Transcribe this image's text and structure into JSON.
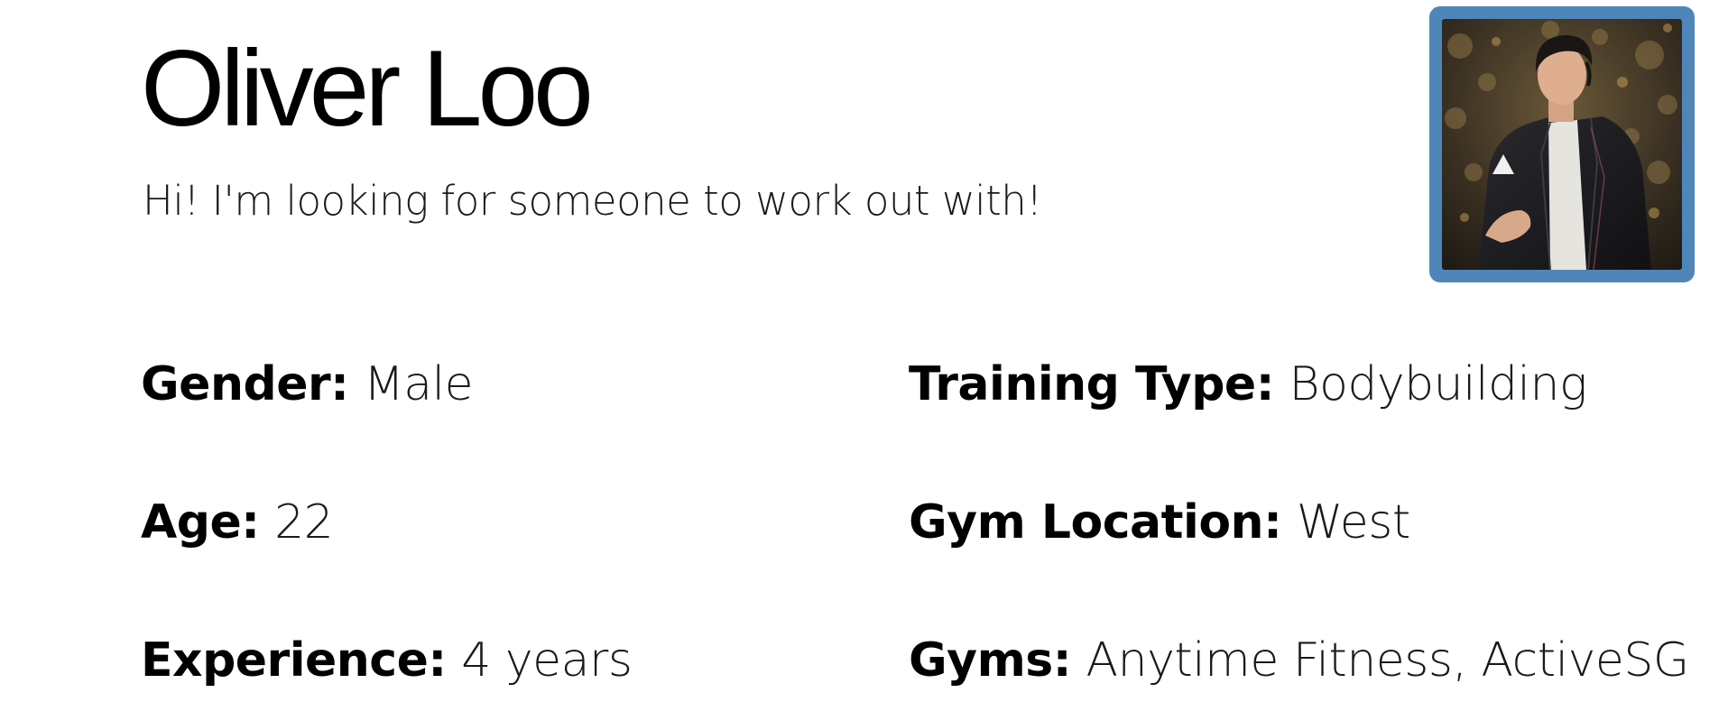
{
  "profile": {
    "name": "Oliver Loo",
    "bio": "Hi! I'm looking for someone to work out with!",
    "avatar_description": "profile photo"
  },
  "details": {
    "gender": {
      "label": "Gender:",
      "value": "Male"
    },
    "age": {
      "label": "Age:",
      "value": "22"
    },
    "experience": {
      "label": "Experience:",
      "value": "4 years"
    },
    "training_type": {
      "label": "Training Type:",
      "value": "Bodybuilding"
    },
    "gym_location": {
      "label": "Gym Location:",
      "value": "West"
    },
    "gyms": {
      "label": "Gyms:",
      "value": "Anytime Fitness, ActiveSG"
    }
  },
  "colors": {
    "avatar_border": "#4f86b9",
    "text": "#000000",
    "background": "#ffffff"
  }
}
